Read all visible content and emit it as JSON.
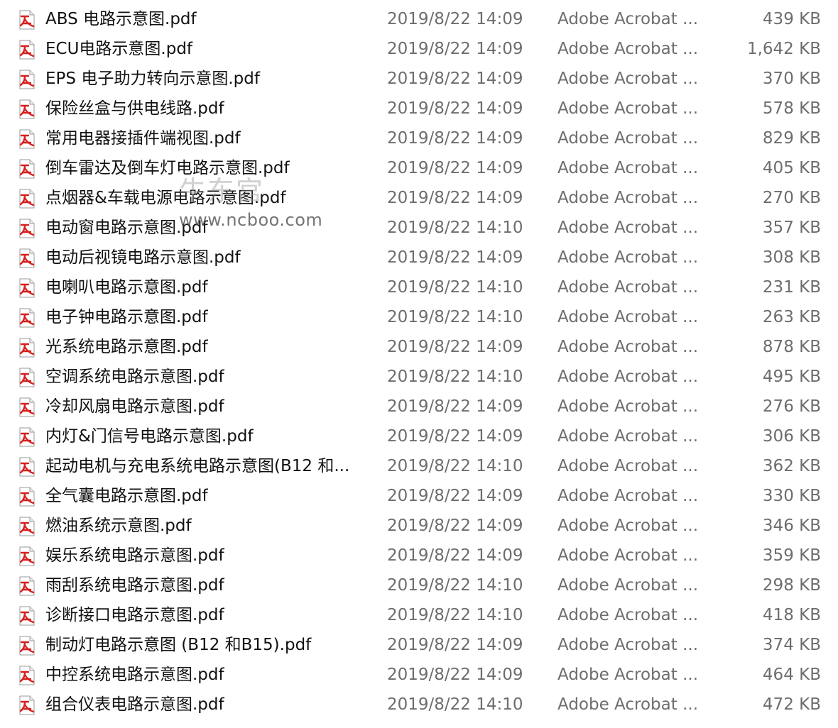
{
  "icon": "pdf-file-icon",
  "colors": {
    "pdf_icon_red": "#d6201f",
    "text": "#111111",
    "secondary_text": "#6d6d6d"
  },
  "files": [
    {
      "name": "ABS 电路示意图.pdf",
      "date": "2019/8/22 14:09",
      "type": "Adobe Acrobat ...",
      "size": "439 KB"
    },
    {
      "name": "ECU电路示意图.pdf",
      "date": "2019/8/22 14:09",
      "type": "Adobe Acrobat ...",
      "size": "1,642 KB"
    },
    {
      "name": "EPS 电子助力转向示意图.pdf",
      "date": "2019/8/22 14:09",
      "type": "Adobe Acrobat ...",
      "size": "370 KB"
    },
    {
      "name": "保险丝盒与供电线路.pdf",
      "date": "2019/8/22 14:09",
      "type": "Adobe Acrobat ...",
      "size": "578 KB"
    },
    {
      "name": "常用电器接插件端视图.pdf",
      "date": "2019/8/22 14:09",
      "type": "Adobe Acrobat ...",
      "size": "829 KB"
    },
    {
      "name": "倒车雷达及倒车灯电路示意图.pdf",
      "date": "2019/8/22 14:09",
      "type": "Adobe Acrobat ...",
      "size": "405 KB"
    },
    {
      "name": "点烟器&车载电源电路示意图.pdf",
      "date": "2019/8/22 14:09",
      "type": "Adobe Acrobat ...",
      "size": "270 KB"
    },
    {
      "name": "电动窗电路示意图.pdf",
      "date": "2019/8/22 14:10",
      "type": "Adobe Acrobat ...",
      "size": "357 KB"
    },
    {
      "name": "电动后视镜电路示意图.pdf",
      "date": "2019/8/22 14:09",
      "type": "Adobe Acrobat ...",
      "size": "308 KB"
    },
    {
      "name": "电喇叭电路示意图.pdf",
      "date": "2019/8/22 14:10",
      "type": "Adobe Acrobat ...",
      "size": "231 KB"
    },
    {
      "name": "电子钟电路示意图.pdf",
      "date": "2019/8/22 14:10",
      "type": "Adobe Acrobat ...",
      "size": "263 KB"
    },
    {
      "name": "光系统电路示意图.pdf",
      "date": "2019/8/22 14:09",
      "type": "Adobe Acrobat ...",
      "size": "878 KB"
    },
    {
      "name": "空调系统电路示意图.pdf",
      "date": "2019/8/22 14:10",
      "type": "Adobe Acrobat ...",
      "size": "495 KB"
    },
    {
      "name": "冷却风扇电路示意图.pdf",
      "date": "2019/8/22 14:09",
      "type": "Adobe Acrobat ...",
      "size": "276 KB"
    },
    {
      "name": "内灯&门信号电路示意图.pdf",
      "date": "2019/8/22 14:09",
      "type": "Adobe Acrobat ...",
      "size": "306 KB"
    },
    {
      "name": "起动电机与充电系统电路示意图(B12 和...",
      "date": "2019/8/22 14:10",
      "type": "Adobe Acrobat ...",
      "size": "362 KB"
    },
    {
      "name": "全气囊电路示意图.pdf",
      "date": "2019/8/22 14:09",
      "type": "Adobe Acrobat ...",
      "size": "330 KB"
    },
    {
      "name": "燃油系统示意图.pdf",
      "date": "2019/8/22 14:09",
      "type": "Adobe Acrobat ...",
      "size": "346 KB"
    },
    {
      "name": "娱乐系统电路示意图.pdf",
      "date": "2019/8/22 14:09",
      "type": "Adobe Acrobat ...",
      "size": "359 KB"
    },
    {
      "name": "雨刮系统电路示意图.pdf",
      "date": "2019/8/22 14:10",
      "type": "Adobe Acrobat ...",
      "size": "298 KB"
    },
    {
      "name": "诊断接口电路示意图.pdf",
      "date": "2019/8/22 14:10",
      "type": "Adobe Acrobat ...",
      "size": "418 KB"
    },
    {
      "name": "制动灯电路示意图 (B12 和B15).pdf",
      "date": "2019/8/22 14:09",
      "type": "Adobe Acrobat ...",
      "size": "374 KB"
    },
    {
      "name": "中控系统电路示意图.pdf",
      "date": "2019/8/22 14:09",
      "type": "Adobe Acrobat ...",
      "size": "464 KB"
    },
    {
      "name": "组合仪表电路示意图.pdf",
      "date": "2019/8/22 14:10",
      "type": "Adobe Acrobat ...",
      "size": "472 KB"
    }
  ],
  "watermark": {
    "logo_text": "牛东宫",
    "url": "www.ncboo.com"
  }
}
